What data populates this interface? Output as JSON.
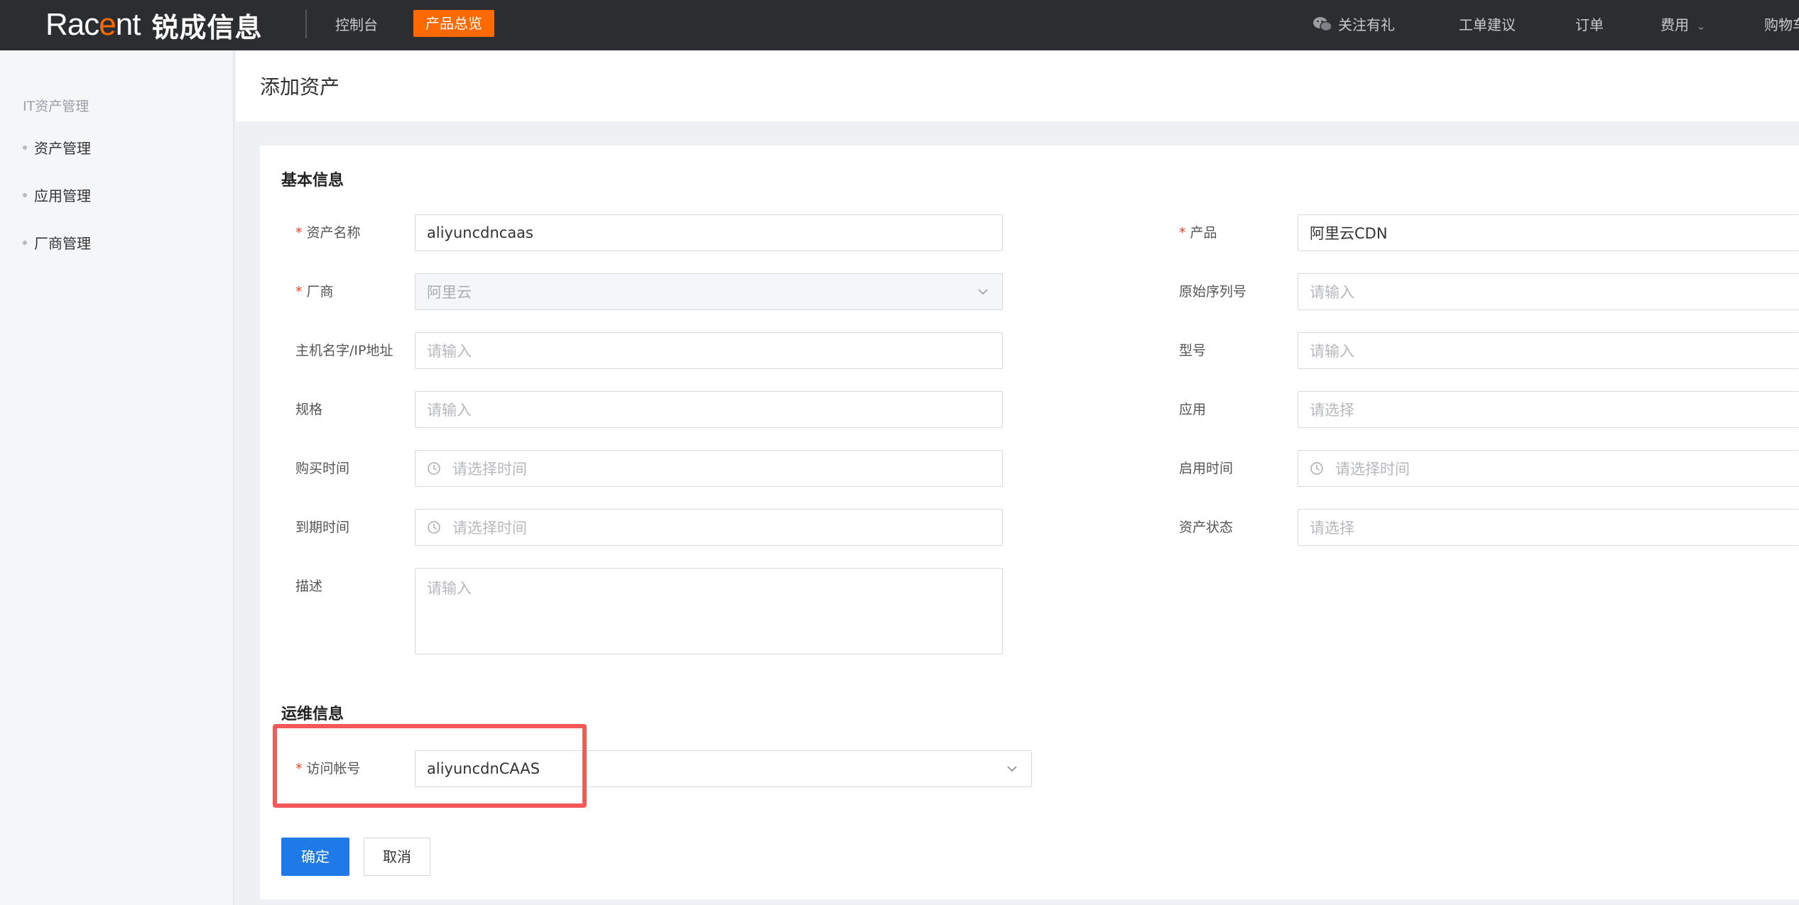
{
  "header": {
    "logo_en_prefix": "Rac",
    "logo_en_accent": "e",
    "logo_en_suffix": "nt",
    "logo_cn": "锐成信息",
    "console": "控制台",
    "product_overview": "产品总览",
    "follow_gift": "关注有礼",
    "ticket_advice": "工单建议",
    "orders": "订单",
    "fees": "费用",
    "fees_caret": "⌄",
    "cart": "购物车"
  },
  "sidebar": {
    "group": "IT资产管理",
    "items": [
      {
        "label": "资产管理"
      },
      {
        "label": "应用管理"
      },
      {
        "label": "厂商管理"
      }
    ]
  },
  "page": {
    "title": "添加资产"
  },
  "basic_info": {
    "title": "基本信息",
    "asset_name": {
      "label": "资产名称",
      "value": "aliyuncdncaas"
    },
    "vendor": {
      "label": "厂商",
      "value": "阿里云"
    },
    "hostname": {
      "label": "主机名字/IP地址",
      "placeholder": "请输入"
    },
    "spec": {
      "label": "规格",
      "placeholder": "请输入"
    },
    "purchase_time": {
      "label": "购买时间",
      "placeholder": "请选择时间"
    },
    "expire_time": {
      "label": "到期时间",
      "placeholder": "请选择时间"
    },
    "description": {
      "label": "描述",
      "placeholder": "请输入"
    },
    "product": {
      "label": "产品",
      "value": "阿里云CDN"
    },
    "serial": {
      "label": "原始序列号",
      "placeholder": "请输入"
    },
    "model": {
      "label": "型号",
      "placeholder": "请输入"
    },
    "application": {
      "label": "应用",
      "placeholder": "请选择"
    },
    "enable_time": {
      "label": "启用时间",
      "placeholder": "请选择时间"
    },
    "asset_status": {
      "label": "资产状态",
      "placeholder": "请选择"
    }
  },
  "ops_info": {
    "title": "运维信息",
    "access_account": {
      "label": "访问帐号",
      "value": "aliyuncdnCAAS"
    }
  },
  "actions": {
    "confirm": "确定",
    "cancel": "取消"
  },
  "colors": {
    "brand_orange": "#ff6a00",
    "primary_blue": "#1f7ae8",
    "highlight_red": "#f25a5a",
    "required_red": "#e8422e"
  }
}
